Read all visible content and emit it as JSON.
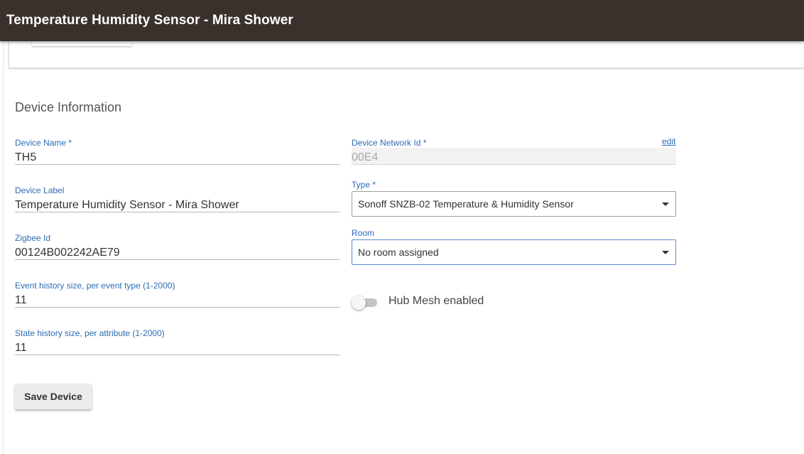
{
  "app_bar": {
    "title": "Temperature Humidity Sensor - Mira Shower"
  },
  "section": {
    "title": "Device Information"
  },
  "fields": {
    "device_name": {
      "label": "Device Name *",
      "value": "TH5"
    },
    "device_label": {
      "label": "Device Label",
      "value": "Temperature Humidity Sensor - Mira Shower"
    },
    "zigbee_id": {
      "label": "Zigbee Id",
      "value": "00124B002242AE79"
    },
    "event_history": {
      "label": "Event history size, per event type (1-2000)",
      "value": "11"
    },
    "state_history": {
      "label": "State history size, per attribute (1-2000)",
      "value": "11"
    },
    "network_id": {
      "label": "Device Network Id *",
      "value": "00E4",
      "edit_label": "edit"
    }
  },
  "type_select": {
    "label": "Type *",
    "selected": "Sonoff SNZB-02 Temperature & Humidity Sensor"
  },
  "room_select": {
    "label": "Room",
    "selected": "No room assigned"
  },
  "hub_mesh": {
    "label": "Hub Mesh enabled",
    "enabled": false
  },
  "actions": {
    "save_label": "Save Device"
  }
}
